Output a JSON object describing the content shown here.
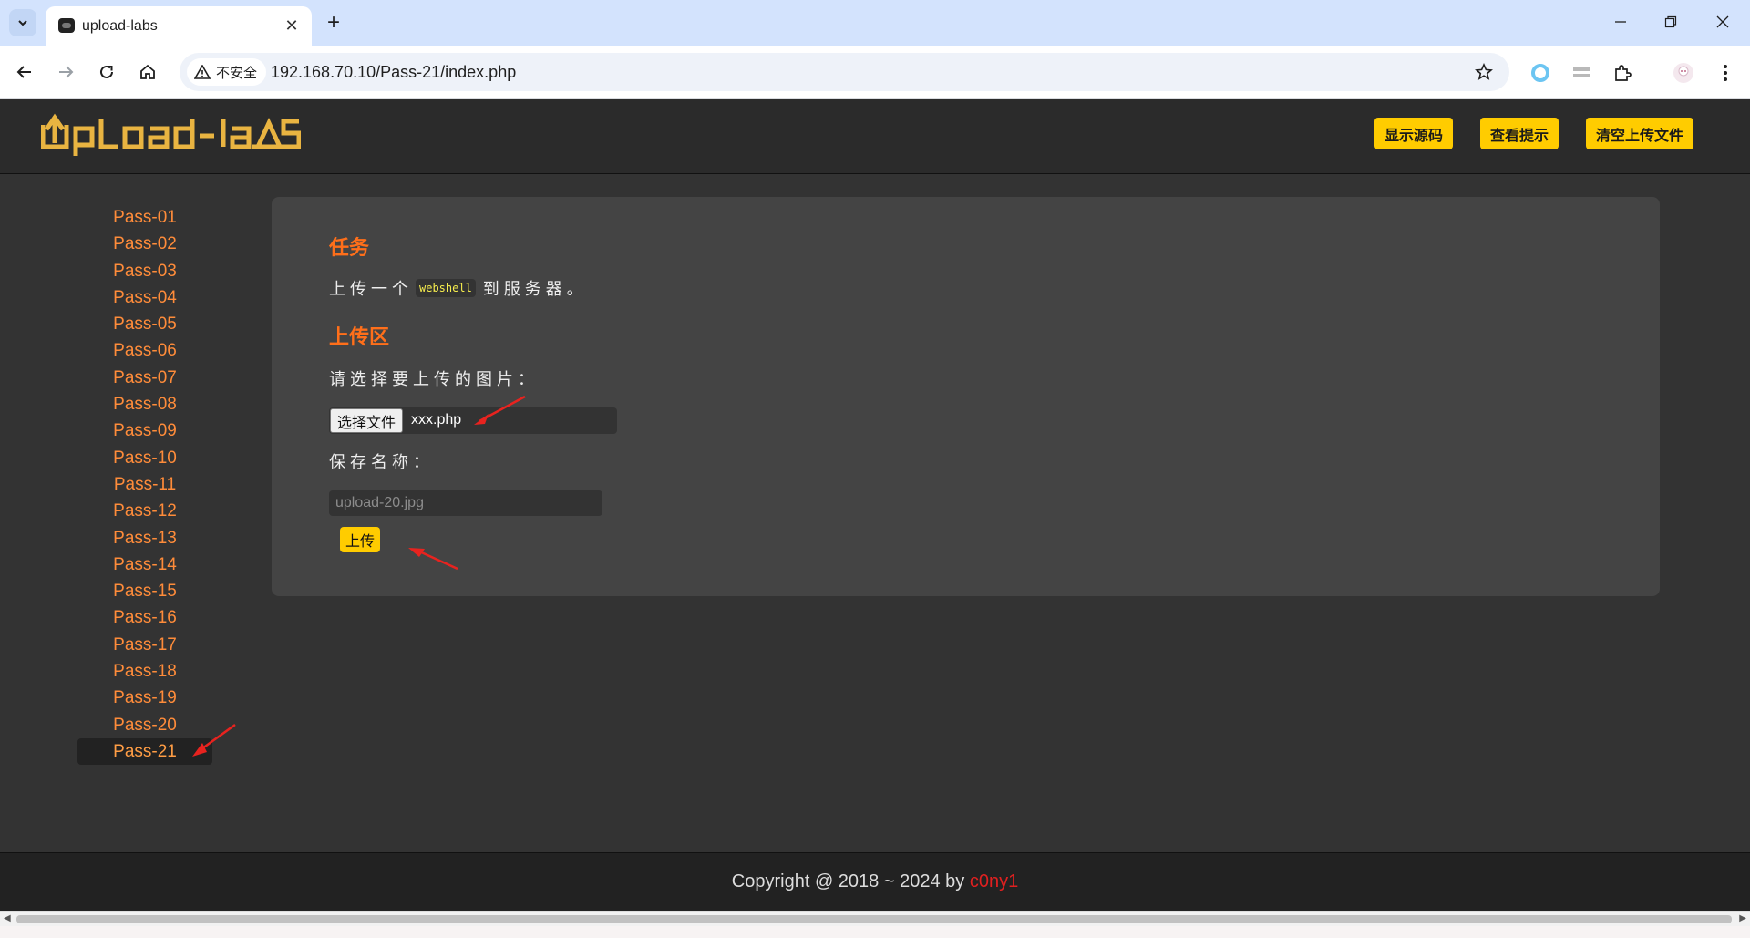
{
  "browser": {
    "tab_title": "upload-labs",
    "security_label": "不安全",
    "url": "192.168.70.10/Pass-21/index.php"
  },
  "header": {
    "logo_text": "UpLoad-labs",
    "buttons": [
      "显示源码",
      "查看提示",
      "清空上传文件"
    ]
  },
  "sidebar": {
    "items": [
      "Pass-01",
      "Pass-02",
      "Pass-03",
      "Pass-04",
      "Pass-05",
      "Pass-06",
      "Pass-07",
      "Pass-08",
      "Pass-09",
      "Pass-10",
      "Pass-11",
      "Pass-12",
      "Pass-13",
      "Pass-14",
      "Pass-15",
      "Pass-16",
      "Pass-17",
      "Pass-18",
      "Pass-19",
      "Pass-20",
      "Pass-21"
    ],
    "active": "Pass-21"
  },
  "task": {
    "heading": "任务",
    "desc_prefix": "上传一个",
    "desc_code": "webshell",
    "desc_suffix": "到服务器。"
  },
  "upload": {
    "heading": "上传区",
    "file_label": "请选择要上传的图片：",
    "file_button": "选择文件",
    "file_name": "xxx.php",
    "save_label": "保存名称：",
    "save_placeholder": "upload-20.jpg",
    "submit_label": "上传"
  },
  "footer": {
    "text": "Copyright @ 2018 ~ 2024 by ",
    "author": "c0ny1"
  },
  "colors": {
    "accent_yellow": "#ffcc00",
    "heading_orange": "#ff6f1a",
    "sidebar_link": "#ff8c3a",
    "annotation_red": "#e8231f"
  }
}
